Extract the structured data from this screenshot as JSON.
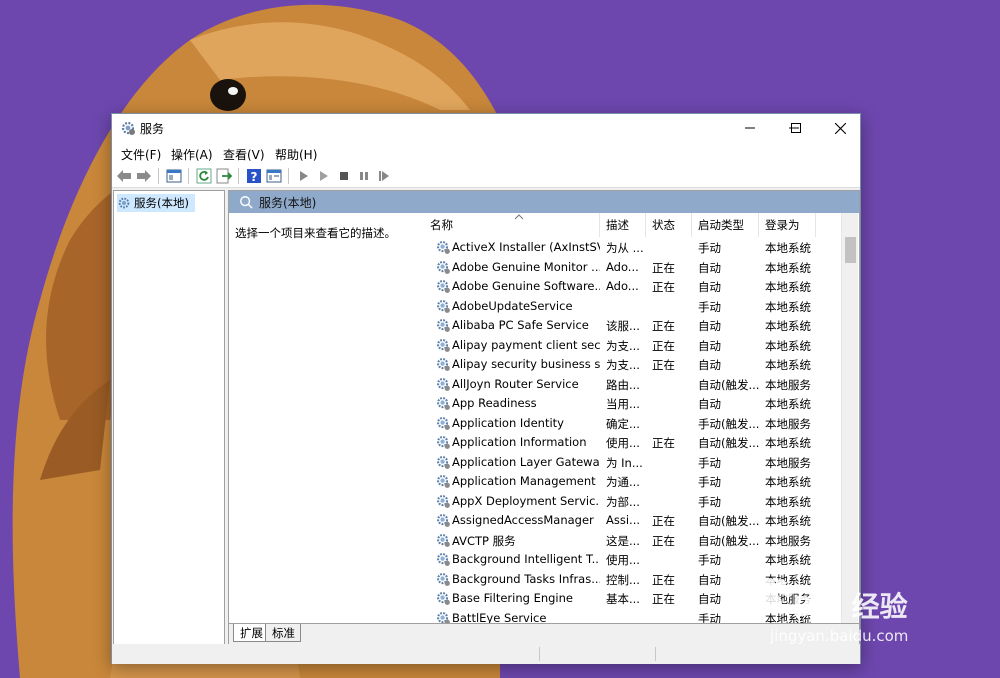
{
  "window": {
    "title": "服务"
  },
  "menu": [
    {
      "label": "文件(F)"
    },
    {
      "label": "操作(A)"
    },
    {
      "label": "查看(V)"
    },
    {
      "label": "帮助(H)"
    }
  ],
  "tree": {
    "root_label": "服务(本地)"
  },
  "main": {
    "header_label": "服务(本地)",
    "description_hint": "选择一个项目来查看它的描述。"
  },
  "columns": [
    {
      "label": "名称"
    },
    {
      "label": "描述"
    },
    {
      "label": "状态"
    },
    {
      "label": "启动类型"
    },
    {
      "label": "登录为"
    }
  ],
  "services": [
    {
      "name": "ActiveX Installer (AxInstSV)",
      "desc": "为从 ...",
      "status": "",
      "startup": "手动",
      "logon": "本地系统"
    },
    {
      "name": "Adobe Genuine Monitor ...",
      "desc": "Ado...",
      "status": "正在",
      "startup": "自动",
      "logon": "本地系统"
    },
    {
      "name": "Adobe Genuine Software...",
      "desc": "Ado...",
      "status": "正在",
      "startup": "自动",
      "logon": "本地系统"
    },
    {
      "name": "AdobeUpdateService",
      "desc": "",
      "status": "",
      "startup": "手动",
      "logon": "本地系统"
    },
    {
      "name": "Alibaba PC Safe Service",
      "desc": "该服...",
      "status": "正在",
      "startup": "自动",
      "logon": "本地系统"
    },
    {
      "name": "Alipay payment client sec...",
      "desc": "为支...",
      "status": "正在",
      "startup": "自动",
      "logon": "本地系统"
    },
    {
      "name": "Alipay security business s...",
      "desc": "为支...",
      "status": "正在",
      "startup": "自动",
      "logon": "本地系统"
    },
    {
      "name": "AllJoyn Router Service",
      "desc": "路由...",
      "status": "",
      "startup": "自动(触发...",
      "logon": "本地服务"
    },
    {
      "name": "App Readiness",
      "desc": "当用...",
      "status": "",
      "startup": "自动",
      "logon": "本地系统"
    },
    {
      "name": "Application Identity",
      "desc": "确定...",
      "status": "",
      "startup": "手动(触发...",
      "logon": "本地服务"
    },
    {
      "name": "Application Information",
      "desc": "使用...",
      "status": "正在",
      "startup": "自动(触发...",
      "logon": "本地系统"
    },
    {
      "name": "Application Layer Gatewa...",
      "desc": "为 In...",
      "status": "",
      "startup": "手动",
      "logon": "本地服务"
    },
    {
      "name": "Application Management",
      "desc": "为通...",
      "status": "",
      "startup": "手动",
      "logon": "本地系统"
    },
    {
      "name": "AppX Deployment Servic...",
      "desc": "为部...",
      "status": "",
      "startup": "手动",
      "logon": "本地系统"
    },
    {
      "name": "AssignedAccessManager",
      "desc": "Assi...",
      "status": "正在",
      "startup": "自动(触发...",
      "logon": "本地系统"
    },
    {
      "name": "AVCTP 服务",
      "desc": "这是...",
      "status": "正在",
      "startup": "自动(触发...",
      "logon": "本地服务"
    },
    {
      "name": "Background Intelligent T...",
      "desc": "使用...",
      "status": "",
      "startup": "手动",
      "logon": "本地系统"
    },
    {
      "name": "Background Tasks Infras...",
      "desc": "控制...",
      "status": "正在",
      "startup": "自动",
      "logon": "本地系统"
    },
    {
      "name": "Base Filtering Engine",
      "desc": "基本...",
      "status": "正在",
      "startup": "自动",
      "logon": "本地服务"
    },
    {
      "name": "BattlEye Service",
      "desc": "",
      "status": "",
      "startup": "手动",
      "logon": "本地系统"
    }
  ],
  "tabs": [
    {
      "label": "扩展"
    },
    {
      "label": "标准"
    }
  ],
  "watermark": {
    "title": "Bai 经验",
    "url": "jingyan.baidu.com"
  }
}
